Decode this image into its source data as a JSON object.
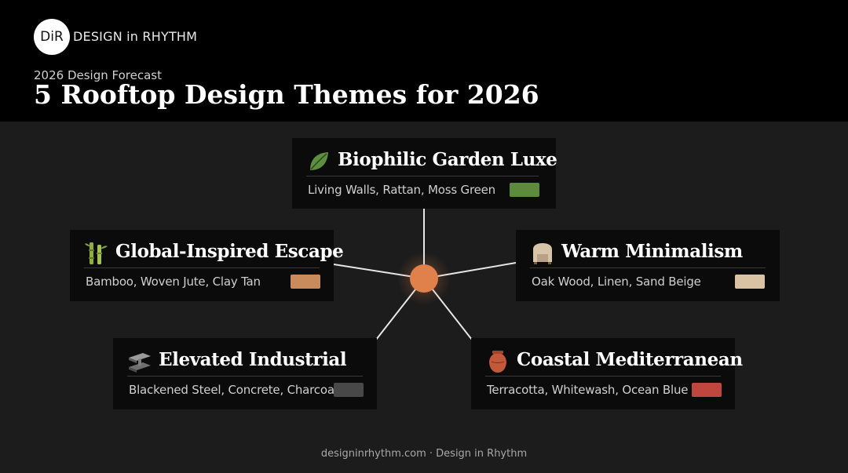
{
  "header": {
    "logo_text": "DiR",
    "brand_name": "DESIGN in RHYTHM",
    "eyebrow": "2026 Design Forecast",
    "title": "5 Rooftop Design Themes for 2026"
  },
  "themes": [
    {
      "name": "Biophilic Garden Luxe",
      "materials": "Living Walls, Rattan, Moss Green",
      "icon": "leaf-icon",
      "swatch_color": "#5e8a3c"
    },
    {
      "name": "Global-Inspired Escape",
      "materials": "Bamboo, Woven Jute, Clay Tan",
      "icon": "bamboo-icon",
      "swatch_color": "#c98a5c"
    },
    {
      "name": "Warm Minimalism",
      "materials": "Oak Wood, Linen, Sand Beige",
      "icon": "armchair-icon",
      "swatch_color": "#d9c3a4"
    },
    {
      "name": "Elevated Industrial",
      "materials": "Blackened Steel, Concrete, Charcoal",
      "icon": "steel-beam-icon",
      "swatch_color": "#484848"
    },
    {
      "name": "Coastal Mediterranean",
      "materials": "Terracotta, Whitewash, Ocean Blue",
      "icon": "clay-pot-icon",
      "swatch_color": "#c0473d"
    }
  ],
  "hub": {
    "color": "#e0804a"
  },
  "footer": "designinrhythm.com · Design in Rhythm"
}
